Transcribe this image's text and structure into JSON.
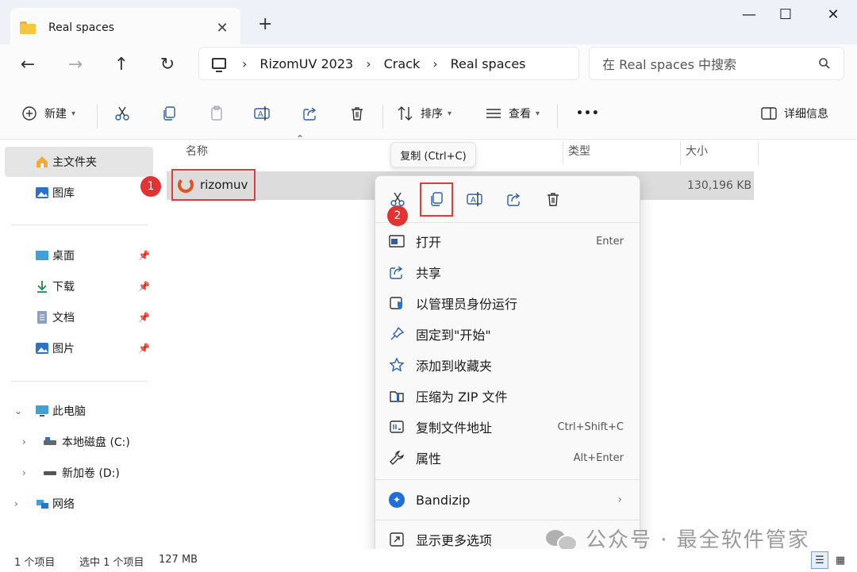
{
  "window": {
    "tab_title": "Real spaces",
    "tab_close": "✕",
    "new_tab": "+",
    "minimize": "—",
    "maximize": "☐",
    "close": "✕"
  },
  "navigation": {
    "back": "←",
    "forward": "→",
    "up": "↑",
    "refresh": "↻",
    "breadcrumb": [
      "RizomUV 2023",
      "Crack",
      "Real spaces"
    ],
    "separator": "›",
    "search_placeholder": "在 Real spaces 中搜索"
  },
  "toolbar": {
    "new_label": "新建",
    "sort_label": "排序",
    "view_label": "查看",
    "more": "•••",
    "details_label": "详细信息"
  },
  "sidebar": {
    "home": "主文件夹",
    "gallery": "图库",
    "desktop": "桌面",
    "downloads": "下载",
    "documents": "文档",
    "pictures": "图片",
    "this_pc": "此电脑",
    "local_disk": "本地磁盘 (C:)",
    "new_volume": "新加卷 (D:)",
    "network": "网络"
  },
  "columns": {
    "name": "名称",
    "type": "类型",
    "size": "大小"
  },
  "file": {
    "name": "rizomuv",
    "size": "130,196 KB"
  },
  "badges": {
    "one": "1",
    "two": "2"
  },
  "tooltip": "复制 (Ctrl+C)",
  "context_menu": {
    "open": {
      "label": "打开",
      "shortcut": "Enter"
    },
    "share": {
      "label": "共享"
    },
    "run_as_admin": {
      "label": "以管理员身份运行"
    },
    "pin_start": {
      "label": "固定到\"开始\""
    },
    "add_favorites": {
      "label": "添加到收藏夹"
    },
    "compress_zip": {
      "label": "压缩为 ZIP 文件"
    },
    "copy_path": {
      "label": "复制文件地址",
      "shortcut": "Ctrl+Shift+C"
    },
    "properties": {
      "label": "属性",
      "shortcut": "Alt+Enter"
    },
    "bandizip": {
      "label": "Bandizip"
    },
    "more_options": {
      "label": "显示更多选项"
    }
  },
  "status": {
    "item_count": "1 个项目",
    "selected": "选中 1 个项目",
    "selected_size": "127 MB"
  },
  "watermark": "公众号 · 最全软件管家",
  "colors": {
    "accent": "#2b5fa7",
    "highlight_red": "#e13b3b"
  }
}
